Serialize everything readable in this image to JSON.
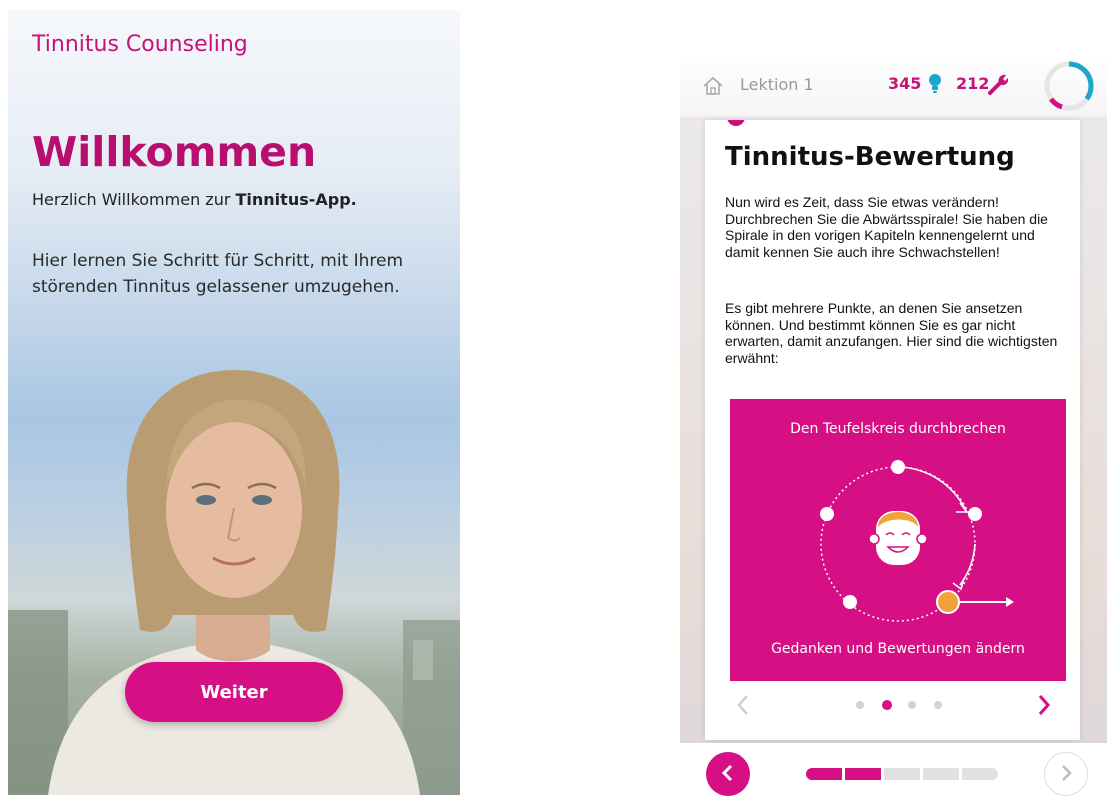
{
  "left_screen": {
    "brand": "Tinnitus Counseling",
    "heading": "Willkommen",
    "intro_prefix": "Herzlich Willkommen zur ",
    "intro_app": "Tinnitus-App.",
    "body": "Hier lernen Sie Schritt für Schritt, mit Ihrem störenden Tinnitus gelassener umzugehen.",
    "button_label": "Weiter"
  },
  "right_screen": {
    "topbar": {
      "home_icon": "home-icon",
      "lesson": "Lektion 1",
      "points": "345",
      "points_icon": "lightbulb-icon",
      "tools": "212",
      "tools_icon": "wrench-icon",
      "progress": 0.35
    },
    "card": {
      "title": "Tinnitus-Bewertung",
      "paragraph1": "Nun wird es Zeit, dass Sie etwas verändern! Durchbrechen Sie die Abwärtsspirale! Sie haben die Spirale in den vorigen Kapiteln kennengelernt und damit kennen Sie auch ihre Schwachstellen!",
      "paragraph2": "Es gibt mehrere Punkte, an denen Sie ansetzen können. Und bestimmt können Sie es gar nicht erwarten, damit anzufangen. Hier sind die wichtigsten erwähnt:",
      "slide_title": "Den Teufelskreis durchbrechen",
      "slide_caption": "Gedanken und Bewertungen ändern",
      "carousel_dots": 4,
      "carousel_active": 2
    },
    "bottom_nav": {
      "steps_total": 5,
      "steps_done": 2
    },
    "colors": {
      "brand": "#d70f84",
      "accent_orange": "#f2a13b"
    }
  }
}
